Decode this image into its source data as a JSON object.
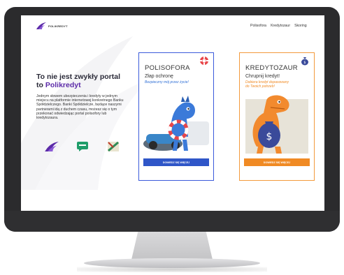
{
  "brand": {
    "name": "POLIKREDYT",
    "accent": "#5b2aa8"
  },
  "nav": {
    "items": [
      "Polisofora",
      "Kredytozaur",
      "Skoring"
    ]
  },
  "hero": {
    "headline_line1": "To nie jest zwykły portal",
    "headline_prefix": "to ",
    "headline_accent": "Polikredyt",
    "paragraph": "Jednym słowem ubezpieczenia i kredyty w jednym miejscu na platformie internetowej konkretnego Banku Spółdzielczego. Banki Spółdzielcze, będące naszymi partnerami idą z duchem czasu, możesz się o tym przekonać odwiedzając portal polisofory lub kredytozaura."
  },
  "badges": [
    {
      "icon": "polikredyt-logo-icon"
    },
    {
      "icon": "chat-icon"
    },
    {
      "icon": "bank-partner-icon"
    }
  ],
  "cards": [
    {
      "title": "POLISOFORA",
      "subtitle": "Złap ochronę",
      "slogan": "Bezpieczny mój przez życie!",
      "button": "DOWIEDZ SIĘ WIĘCEJ",
      "icon": "lifebuoy-icon",
      "color": "#3b5bdb"
    },
    {
      "title": "KREDYTOZAUR",
      "subtitle": "Chrupnij kredyt!",
      "slogan_line1": "Dobiera kredyt dopasowany",
      "slogan_line2": "do Twoich potrzeb!",
      "button": "DOWIEDZ SIĘ WIĘCEJ",
      "icon": "money-bag-icon",
      "color": "#f39a3c"
    }
  ]
}
